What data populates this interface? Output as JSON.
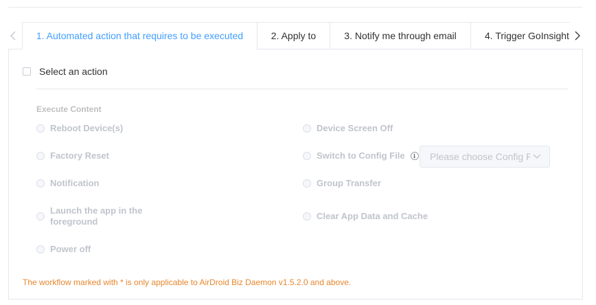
{
  "tabs": [
    {
      "label": "1. Automated action that requires to be executed",
      "active": true
    },
    {
      "label": "2. Apply to",
      "active": false
    },
    {
      "label": "3. Notify me through email",
      "active": false
    },
    {
      "label": "4. Trigger GoInsight",
      "active": false
    }
  ],
  "select_action": {
    "label": "Select an action",
    "checked": false
  },
  "execute_content": {
    "label": "Execute Content",
    "left_options": [
      {
        "label": "Reboot Device(s)"
      },
      {
        "label": "Factory Reset"
      },
      {
        "label": "Notification"
      },
      {
        "label_line1": "Launch the app in the",
        "label_line2": "foreground"
      },
      {
        "label": "Power off"
      }
    ],
    "right_options": [
      {
        "label": "Device Screen Off"
      },
      {
        "label": "Switch to Config File"
      },
      {
        "label": "Group Transfer"
      },
      {
        "label": "Clear App Data and Cache"
      }
    ],
    "config_select": {
      "placeholder": "Please choose Config File"
    }
  },
  "notice": "The workflow marked with * is only applicable to AirDroid Biz Daemon v1.5.2.0 and above.",
  "colors": {
    "accent": "#409eff",
    "notice": "#e6862d",
    "disabled_text": "#c0c4cc"
  },
  "icons": {
    "prev": "chevron-left-icon",
    "next": "chevron-right-icon",
    "info": "info-icon",
    "dropdown": "chevron-down-icon"
  }
}
